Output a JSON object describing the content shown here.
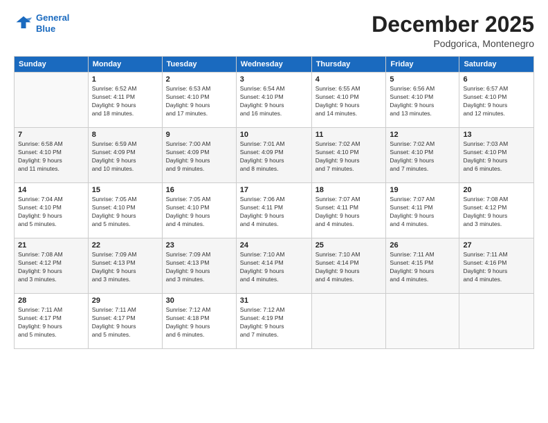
{
  "logo": {
    "line1": "General",
    "line2": "Blue"
  },
  "title": "December 2025",
  "location": "Podgorica, Montenegro",
  "days_header": [
    "Sunday",
    "Monday",
    "Tuesday",
    "Wednesday",
    "Thursday",
    "Friday",
    "Saturday"
  ],
  "weeks": [
    [
      {
        "day": "",
        "info": ""
      },
      {
        "day": "1",
        "info": "Sunrise: 6:52 AM\nSunset: 4:11 PM\nDaylight: 9 hours\nand 18 minutes."
      },
      {
        "day": "2",
        "info": "Sunrise: 6:53 AM\nSunset: 4:10 PM\nDaylight: 9 hours\nand 17 minutes."
      },
      {
        "day": "3",
        "info": "Sunrise: 6:54 AM\nSunset: 4:10 PM\nDaylight: 9 hours\nand 16 minutes."
      },
      {
        "day": "4",
        "info": "Sunrise: 6:55 AM\nSunset: 4:10 PM\nDaylight: 9 hours\nand 14 minutes."
      },
      {
        "day": "5",
        "info": "Sunrise: 6:56 AM\nSunset: 4:10 PM\nDaylight: 9 hours\nand 13 minutes."
      },
      {
        "day": "6",
        "info": "Sunrise: 6:57 AM\nSunset: 4:10 PM\nDaylight: 9 hours\nand 12 minutes."
      }
    ],
    [
      {
        "day": "7",
        "info": "Sunrise: 6:58 AM\nSunset: 4:10 PM\nDaylight: 9 hours\nand 11 minutes."
      },
      {
        "day": "8",
        "info": "Sunrise: 6:59 AM\nSunset: 4:09 PM\nDaylight: 9 hours\nand 10 minutes."
      },
      {
        "day": "9",
        "info": "Sunrise: 7:00 AM\nSunset: 4:09 PM\nDaylight: 9 hours\nand 9 minutes."
      },
      {
        "day": "10",
        "info": "Sunrise: 7:01 AM\nSunset: 4:09 PM\nDaylight: 9 hours\nand 8 minutes."
      },
      {
        "day": "11",
        "info": "Sunrise: 7:02 AM\nSunset: 4:10 PM\nDaylight: 9 hours\nand 7 minutes."
      },
      {
        "day": "12",
        "info": "Sunrise: 7:02 AM\nSunset: 4:10 PM\nDaylight: 9 hours\nand 7 minutes."
      },
      {
        "day": "13",
        "info": "Sunrise: 7:03 AM\nSunset: 4:10 PM\nDaylight: 9 hours\nand 6 minutes."
      }
    ],
    [
      {
        "day": "14",
        "info": "Sunrise: 7:04 AM\nSunset: 4:10 PM\nDaylight: 9 hours\nand 5 minutes."
      },
      {
        "day": "15",
        "info": "Sunrise: 7:05 AM\nSunset: 4:10 PM\nDaylight: 9 hours\nand 5 minutes."
      },
      {
        "day": "16",
        "info": "Sunrise: 7:05 AM\nSunset: 4:10 PM\nDaylight: 9 hours\nand 4 minutes."
      },
      {
        "day": "17",
        "info": "Sunrise: 7:06 AM\nSunset: 4:11 PM\nDaylight: 9 hours\nand 4 minutes."
      },
      {
        "day": "18",
        "info": "Sunrise: 7:07 AM\nSunset: 4:11 PM\nDaylight: 9 hours\nand 4 minutes."
      },
      {
        "day": "19",
        "info": "Sunrise: 7:07 AM\nSunset: 4:11 PM\nDaylight: 9 hours\nand 4 minutes."
      },
      {
        "day": "20",
        "info": "Sunrise: 7:08 AM\nSunset: 4:12 PM\nDaylight: 9 hours\nand 3 minutes."
      }
    ],
    [
      {
        "day": "21",
        "info": "Sunrise: 7:08 AM\nSunset: 4:12 PM\nDaylight: 9 hours\nand 3 minutes."
      },
      {
        "day": "22",
        "info": "Sunrise: 7:09 AM\nSunset: 4:13 PM\nDaylight: 9 hours\nand 3 minutes."
      },
      {
        "day": "23",
        "info": "Sunrise: 7:09 AM\nSunset: 4:13 PM\nDaylight: 9 hours\nand 3 minutes."
      },
      {
        "day": "24",
        "info": "Sunrise: 7:10 AM\nSunset: 4:14 PM\nDaylight: 9 hours\nand 4 minutes."
      },
      {
        "day": "25",
        "info": "Sunrise: 7:10 AM\nSunset: 4:14 PM\nDaylight: 9 hours\nand 4 minutes."
      },
      {
        "day": "26",
        "info": "Sunrise: 7:11 AM\nSunset: 4:15 PM\nDaylight: 9 hours\nand 4 minutes."
      },
      {
        "day": "27",
        "info": "Sunrise: 7:11 AM\nSunset: 4:16 PM\nDaylight: 9 hours\nand 4 minutes."
      }
    ],
    [
      {
        "day": "28",
        "info": "Sunrise: 7:11 AM\nSunset: 4:17 PM\nDaylight: 9 hours\nand 5 minutes."
      },
      {
        "day": "29",
        "info": "Sunrise: 7:11 AM\nSunset: 4:17 PM\nDaylight: 9 hours\nand 5 minutes."
      },
      {
        "day": "30",
        "info": "Sunrise: 7:12 AM\nSunset: 4:18 PM\nDaylight: 9 hours\nand 6 minutes."
      },
      {
        "day": "31",
        "info": "Sunrise: 7:12 AM\nSunset: 4:19 PM\nDaylight: 9 hours\nand 7 minutes."
      },
      {
        "day": "",
        "info": ""
      },
      {
        "day": "",
        "info": ""
      },
      {
        "day": "",
        "info": ""
      }
    ]
  ]
}
